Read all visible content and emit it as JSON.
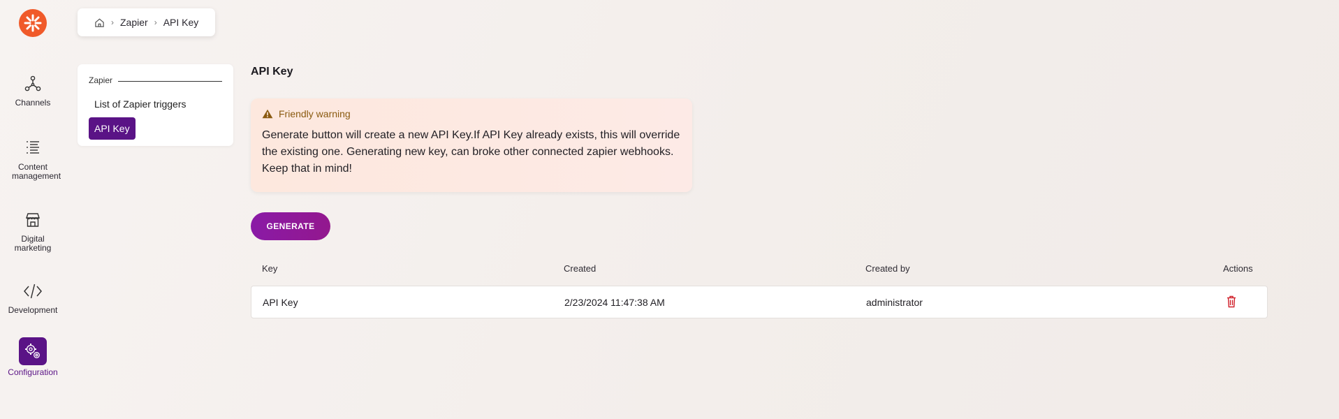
{
  "sidebar": {
    "items": [
      {
        "label": "Channels",
        "icon": "channels-icon"
      },
      {
        "label": "Content management",
        "icon": "content-icon"
      },
      {
        "label": "Digital marketing",
        "icon": "store-icon"
      },
      {
        "label": "Development",
        "icon": "code-icon"
      },
      {
        "label": "Configuration",
        "icon": "gear-icon",
        "active": true
      }
    ],
    "accent": "#5a1386",
    "logo_color": "#f05a2a"
  },
  "breadcrumb": {
    "items": [
      "Zapier",
      "API Key"
    ]
  },
  "subnav": {
    "group": "Zapier",
    "items": [
      "List of Zapier triggers",
      "API Key"
    ],
    "active": "API Key"
  },
  "main": {
    "title": "API Key",
    "warning": {
      "title": "Friendly warning",
      "text": "Generate button will create a new API Key.If API Key already exists, this will override the existing one. Generating new key, can broke other connected zapier webhooks. Keep that in mind!"
    },
    "generate_label": "GENERATE",
    "table": {
      "columns": [
        "Key",
        "Created",
        "Created by",
        "Actions"
      ],
      "rows": [
        {
          "key": "API Key",
          "created": "2/23/2024 11:47:38 AM",
          "created_by": "administrator"
        }
      ]
    }
  }
}
